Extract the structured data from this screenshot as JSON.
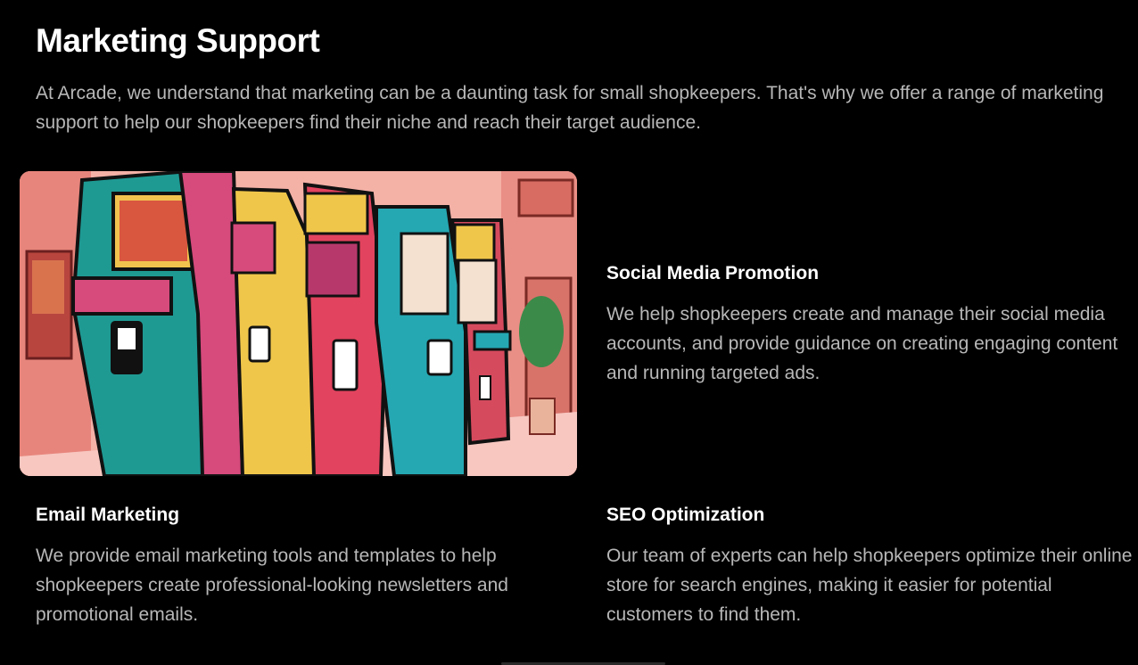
{
  "section": {
    "title": "Marketing Support",
    "intro": "At Arcade, we understand that marketing can be a daunting task for small shopkeepers. That's why we offer a range of marketing support to help our shopkeepers find their niche and reach their target audience."
  },
  "features": {
    "social": {
      "title": "Social Media Promotion",
      "text": "We help shopkeepers create and manage their social media accounts, and provide guidance on creating engaging content and running targeted ads."
    },
    "email": {
      "title": "Email Marketing",
      "text": "We provide email marketing tools and templates to help shopkeepers create professional-looking newsletters and promotional emails."
    },
    "seo": {
      "title": "SEO Optimization",
      "text": "Our team of experts can help shopkeepers optimize their online store for search engines, making it easier for potential customers to find them."
    }
  },
  "colors": {
    "background": "#000000",
    "heading": "#ffffff",
    "body_text": "#b7b7b7"
  }
}
